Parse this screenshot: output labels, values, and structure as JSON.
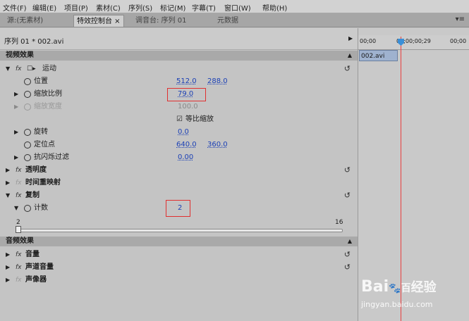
{
  "menu": [
    "文件(F)",
    "编辑(E)",
    "项目(P)",
    "素材(C)",
    "序列(S)",
    "标记(M)",
    "字幕(T)",
    "窗口(W)",
    "帮助(H)"
  ],
  "tabs": [
    {
      "label": "源:(无素材)",
      "active": false
    },
    {
      "label": "特效控制台 ×",
      "active": true
    },
    {
      "label": "调音台: 序列 01",
      "active": false
    },
    {
      "label": "元数据",
      "active": false
    }
  ],
  "sequence": {
    "title": "序列 01 * 002.avi"
  },
  "video_section": {
    "title": "视频效果"
  },
  "motion": {
    "label": "运动"
  },
  "properties": {
    "position": {
      "label": "位置",
      "x": "512.0",
      "y": "288.0"
    },
    "scale": {
      "label": "缩放比例",
      "value": "79.0"
    },
    "scale_width": {
      "label": "缩放宽度",
      "value": "100.0"
    },
    "uniform_scale": {
      "label": "等比缩放",
      "checkbox": "☑"
    },
    "rotation": {
      "label": "旋转",
      "value": "0.0"
    },
    "anchor": {
      "label": "定位点",
      "x": "640.0",
      "y": "360.0"
    },
    "flicker": {
      "label": "抗闪烁过滤",
      "value": "0.00"
    }
  },
  "opacity": {
    "label": "透明度"
  },
  "time_remap": {
    "label": "时间重映射"
  },
  "replicate": {
    "label": "复制"
  },
  "count": {
    "label": "计数",
    "value": "2",
    "slider_min": "2",
    "slider_max": "16"
  },
  "audio_section": {
    "title": "音频效果"
  },
  "volume": {
    "label": "音量"
  },
  "channel_volume": {
    "label": "声道音量"
  },
  "panner": {
    "label": "声像器"
  },
  "timeline": {
    "t0": "00;00",
    "t1": "00;00;00;29",
    "t2": "00;00",
    "clip": "002.avi"
  },
  "watermark": {
    "brand": "Bai",
    "brand2": "百",
    "brand_suffix": "经验",
    "url": "jingyan.baidu.com"
  },
  "colors": {
    "playhead": "#e84040",
    "highlight": "#e03030",
    "value": "#1a3fb5"
  }
}
